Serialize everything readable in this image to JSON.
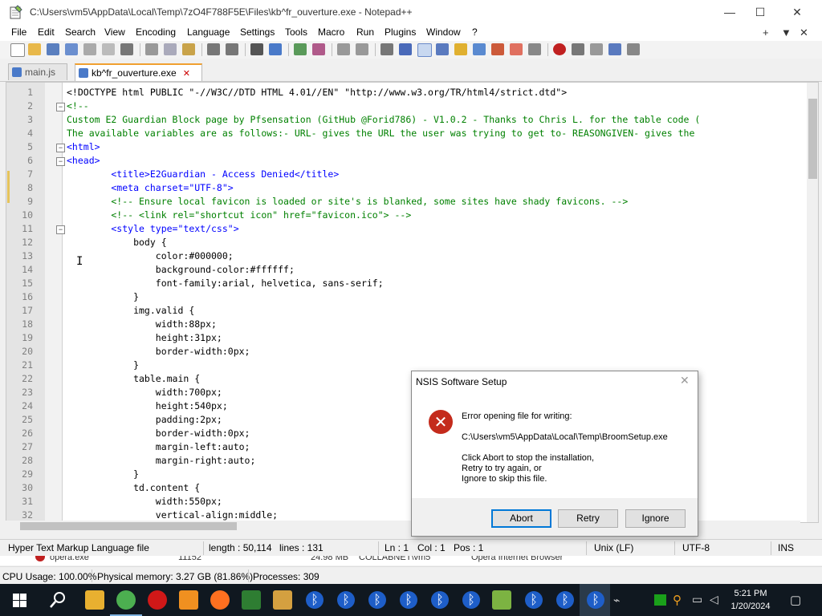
{
  "window": {
    "title": "C:\\Users\\vm5\\AppData\\Local\\Temp\\7zO4F788F5E\\Files\\kb^fr_ouverture.exe - Notepad++",
    "minimize": "—",
    "maximize": "☐",
    "close": "✕"
  },
  "menu": {
    "items": [
      "File",
      "Edit",
      "Search",
      "View",
      "Encoding",
      "Language",
      "Settings",
      "Tools",
      "Macro",
      "Run",
      "Plugins",
      "Window",
      "?"
    ],
    "right": [
      "+",
      "▼",
      "✕"
    ]
  },
  "tabs": [
    {
      "label": "main.js",
      "active": false
    },
    {
      "label": "kb^fr_ouverture.exe",
      "active": true,
      "close": "✕"
    }
  ],
  "editor": {
    "line_numbers": [
      "1",
      "2",
      "3",
      "4",
      "5",
      "6",
      "7",
      "8",
      "9",
      "10",
      "11",
      "12",
      "13",
      "14",
      "15",
      "16",
      "17",
      "18",
      "19",
      "20",
      "21",
      "22",
      "23",
      "24",
      "25",
      "26",
      "27",
      "28",
      "29",
      "30",
      "31",
      "32"
    ],
    "lines": [
      "<!DOCTYPE html PUBLIC \"-//W3C//DTD HTML 4.01//EN\" \"http://www.w3.org/TR/html4/strict.dtd\">",
      "<!--",
      "Custom E2 Guardian Block page by Pfsensation (GitHub @Forid786) - V1.0.2 - Thanks to Chris L. for the table code (",
      "The available variables are as follows:- URL- gives the URL the user was trying to get to- REASONGIVEN- gives the",
      "<html>",
      "<head>",
      "        <title>E2Guardian - Access Denied</title>",
      "        <meta charset=\"UTF-8\">",
      "        <!-- Ensure local favicon is loaded or site's is blanked, some sites have shady favicons. -->",
      "        <!-- <link rel=\"shortcut icon\" href=\"favicon.ico\"> -->",
      "        <style type=\"text/css\">",
      "            body {",
      "                color:#000000;",
      "                background-color:#ffffff;",
      "                font-family:arial, helvetica, sans-serif;",
      "            }",
      "            img.valid {",
      "                width:88px;",
      "                height:31px;",
      "                border-width:0px;",
      "            }",
      "            table.main {",
      "                width:700px;",
      "                height:540px;",
      "                padding:2px;",
      "                border-width:0px;",
      "                margin-left:auto;",
      "                margin-right:auto;",
      "            }",
      "            td.content {",
      "                width:550px;",
      "                vertical-align:middle;"
    ]
  },
  "statusbar": {
    "filetype": "Hyper Text Markup Language file",
    "length": "length : 50,114",
    "lines": "lines : 131",
    "ln": "Ln : 1",
    "col": "Col : 1",
    "pos": "Pos : 1",
    "eol": "Unix (LF)",
    "encoding": "UTF-8",
    "mode": "INS"
  },
  "background_window": {
    "row_partial": "opera.exe",
    "row_pid": "11152",
    "row_mem": "24.98 MB",
    "row_user": "COLLABNET\\vm5",
    "row_desc": "Opera Internet Browser",
    "cpu": "CPU Usage: 100.00%",
    "memory": "Physical memory: 3.27 GB (81.86%)",
    "processes": "Processes: 309"
  },
  "dialog": {
    "title": "NSIS Software Setup",
    "close": "✕",
    "message_line1": "Error opening file for writing:",
    "message_path": "C:\\Users\\vm5\\AppData\\Local\\Temp\\BroomSetup.exe",
    "message_line3": "Click Abort to stop the installation,",
    "message_line4": "Retry to try again, or",
    "message_line5": "Ignore to skip this file.",
    "buttons": [
      "Abort",
      "Retry",
      "Ignore"
    ],
    "icon": "error-icon"
  },
  "taskbar": {
    "time": "5:21 PM",
    "date": "1/20/2024"
  },
  "colors": {
    "tag": "#0000ff",
    "attr": "#ff0000",
    "string": "#8000ff",
    "comment": "#008000",
    "error": "#c42b1c",
    "taskbar": "#101820"
  }
}
